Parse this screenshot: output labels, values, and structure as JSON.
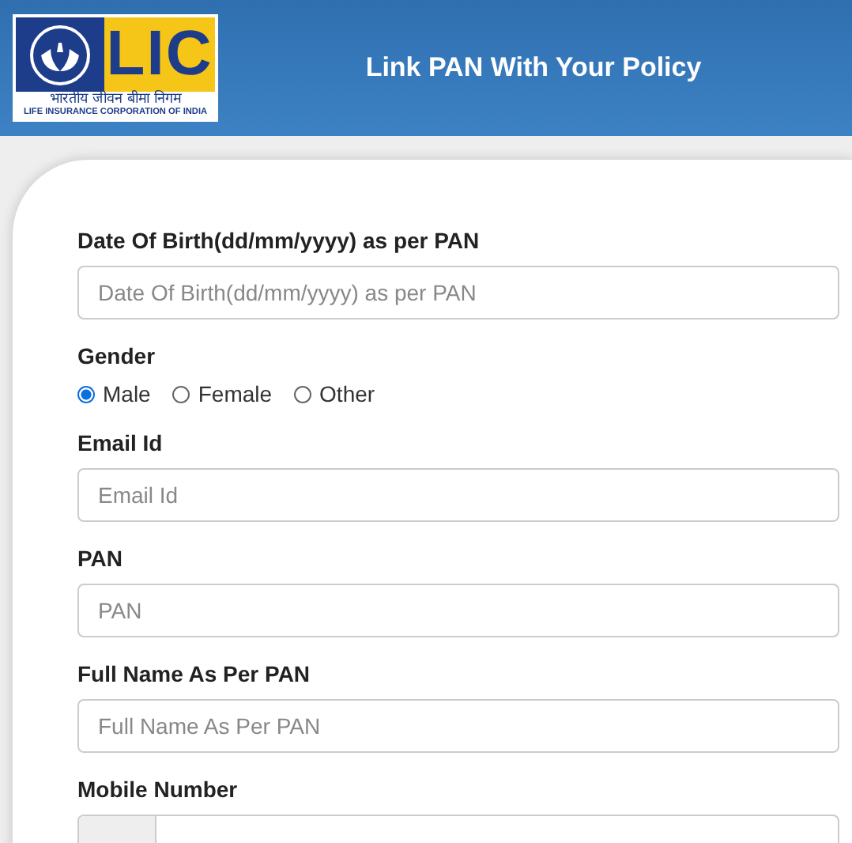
{
  "header": {
    "logo": {
      "mark": "LIC",
      "hindi": "भारतीय जीवन बीमा निगम",
      "english": "LIFE INSURANCE CORPORATION OF INDIA"
    },
    "title": "Link PAN With Your Policy"
  },
  "form": [
    {
      "kind": "text",
      "label": "Date Of Birth(dd/mm/yyyy) as per PAN",
      "placeholder": "Date Of Birth(dd/mm/yyyy) as per PAN"
    },
    {
      "kind": "radio",
      "label": "Gender",
      "options": [
        {
          "label": "Male",
          "selected": true
        },
        {
          "label": "Female",
          "selected": false
        },
        {
          "label": "Other",
          "selected": false
        }
      ]
    },
    {
      "kind": "text",
      "label": "Email Id",
      "placeholder": "Email Id"
    },
    {
      "kind": "text",
      "label": "PAN",
      "placeholder": "PAN"
    },
    {
      "kind": "text",
      "label": "Full Name As Per PAN",
      "placeholder": "Full Name As Per PAN"
    },
    {
      "kind": "prefixed",
      "label": "Mobile Number"
    }
  ]
}
